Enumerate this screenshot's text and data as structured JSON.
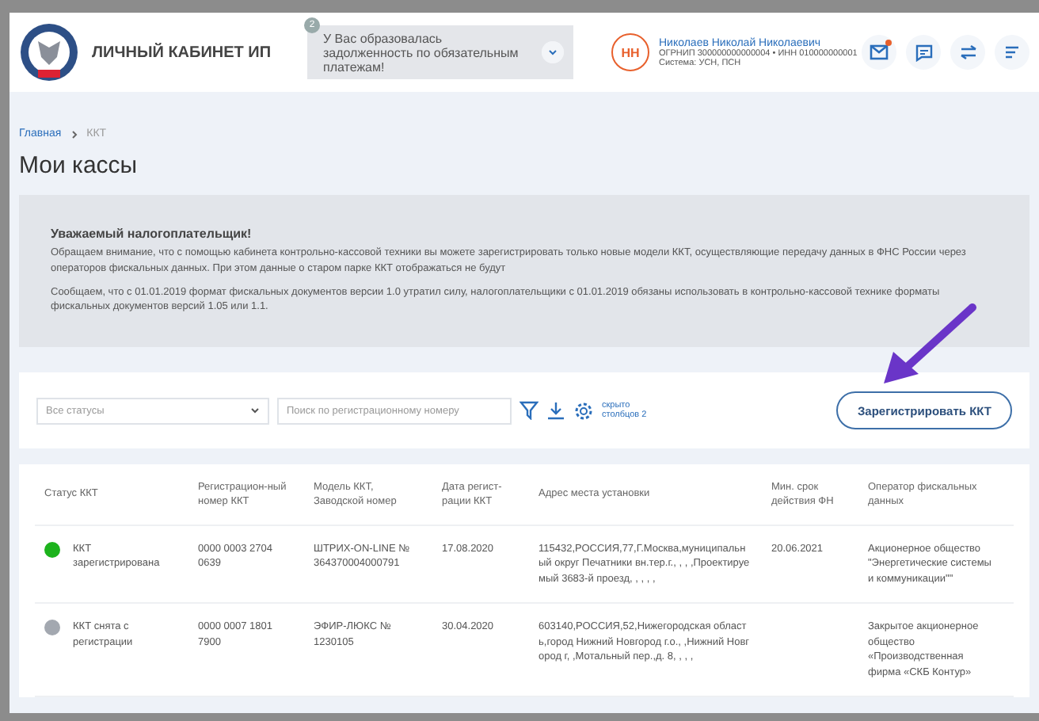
{
  "header": {
    "title": "ЛИЧНЫЙ КАБИНЕТ ИП",
    "notice": {
      "count": "2",
      "text": "У Вас образовалась задолженность по обязательным платежам!"
    },
    "user": {
      "initials": "НН",
      "name": "Николаев Николай Николаевич",
      "ids": "ОГРНИП 300000000000004 • ИНН 010000000001",
      "system": "Система: УСН, ПСН"
    },
    "mail_unread": true
  },
  "breadcrumbs": [
    {
      "label": "Главная",
      "kind": "link"
    },
    {
      "label": "ККТ",
      "kind": "current"
    }
  ],
  "page_title": "Мои кассы",
  "notice_panel": {
    "heading": "Уважаемый налогоплательщик!",
    "paragraphs": [
      "Обращаем внимание, что с помощью кабинета контрольно-кассовой техники вы можете зарегистрировать только новые модели ККТ, осуществляющие передачу данных в ФНС России через операторов фискальных данных. При этом данные о старом парке ККТ отображаться не будут",
      "Сообщаем, что с 01.01.2019 формат фискальных документов версии 1.0 утратил силу, налогоплательщики с 01.01.2019 обязаны использовать в контрольно-кассовой технике форматы фискальных документов версий 1.05 или 1.1."
    ]
  },
  "toolbar": {
    "status_filter": {
      "value": "Все статусы"
    },
    "search": {
      "placeholder": "Поиск по регистрационному номеру"
    },
    "hidden_columns": "скрыто столбцов 2",
    "register_button": "Зарегистрировать ККТ"
  },
  "table": {
    "columns": [
      "Статус ККТ",
      "Регистрацион-ный номер ККТ",
      "Модель ККТ, Заводской номер",
      "Дата регист-рации ККТ",
      "Адрес места установки",
      "Мин. срок действия ФН",
      "Оператор фискальных данных"
    ],
    "rows": [
      {
        "status": "ККТ зарегистрирована",
        "color": "#1db31d",
        "reg_number": "0000 0003 2704 0639",
        "model": "ШТРИХ-ON-LINE № 364370004000791",
        "date": "17.08.2020",
        "address": "115432,РОССИЯ,77,Г.Москва,муниципальный округ Печатники вн.тер.г., , , ,Проектируемый 3683-й проезд, , , , ,",
        "fn_term": "20.06.2021",
        "operator": "Акционерное общество \"Энергетические системы и коммуникации\"\""
      },
      {
        "status": "ККТ снята с регистрации",
        "color": "#a3a8b0",
        "reg_number": "0000 0007 1801 7900",
        "model": "ЭФИР-ЛЮКС № 1230105",
        "date": "30.04.2020",
        "address": "603140,РОССИЯ,52,Нижегородская область,город Нижний Новгород г.о., ,Нижний Новгород г, ,Мотальный пер.,д. 8, , , ,",
        "fn_term": "",
        "operator": "Закрытое акционерное общество «Производственная фирма «СКБ Контур»"
      }
    ]
  }
}
